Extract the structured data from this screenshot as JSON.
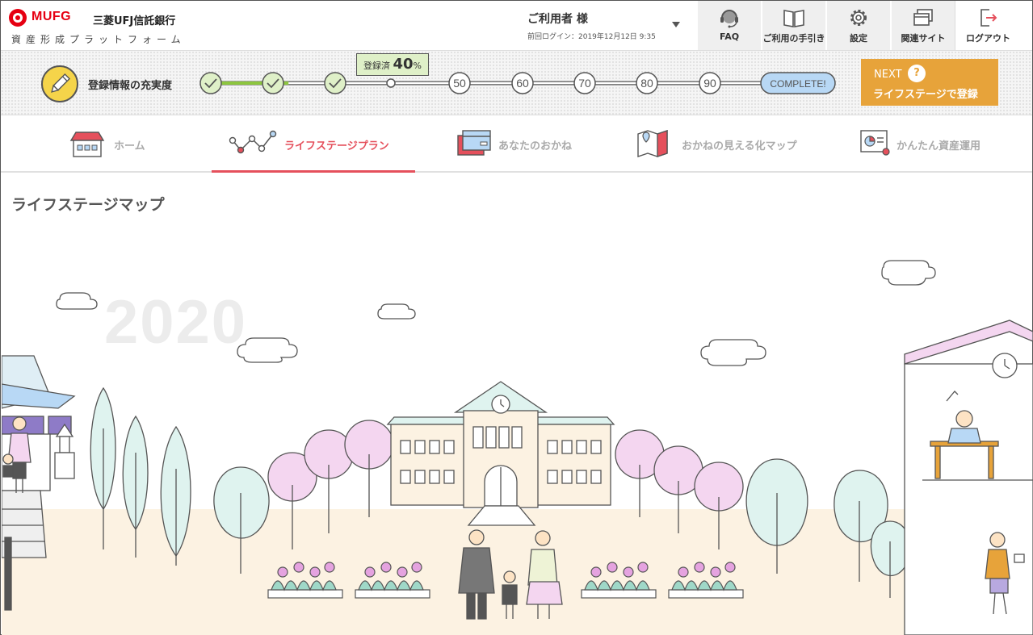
{
  "brand": {
    "logo_text": "MUFG",
    "bank_name": "三菱UFJ信託銀行",
    "platform_name": "資産形成プラットフォーム",
    "red": "#e60012"
  },
  "user": {
    "name_label": "ご利用者 様",
    "last_login": "前回ログイン：2019年12月12日 9:35"
  },
  "nav": {
    "faq": "FAQ",
    "guide": "ご利用の手引き",
    "settings": "設定",
    "related": "関連サイト",
    "logout": "ログアウト"
  },
  "progress": {
    "label": "登録情報の充実度",
    "bubble_prefix": "登録済",
    "percent": "40",
    "percent_unit": "%",
    "completed_fraction": 0.4,
    "steps": [
      "50",
      "60",
      "70",
      "80",
      "90"
    ],
    "complete_label": "COMPLETE!",
    "next_label": "NEXT",
    "help_label": "?",
    "next_action": "ライフステージで登録"
  },
  "tabs": [
    {
      "label": "ホーム"
    },
    {
      "label": "ライフステージプラン"
    },
    {
      "label": "あなたのおかね"
    },
    {
      "label": "おかねの見える化マップ"
    },
    {
      "label": "かんたん資産運用"
    }
  ],
  "page": {
    "title": "ライフステージマップ",
    "year": "2020"
  },
  "colors": {
    "accent": "#e5505c",
    "progress_green": "#8dc63f",
    "next_orange": "#e7a33a",
    "pencil_yellow": "#f5d44a",
    "tree_mint": "#dff3ef",
    "blossom_pink": "#f4d6f0",
    "ground": "#fcf2e2"
  }
}
